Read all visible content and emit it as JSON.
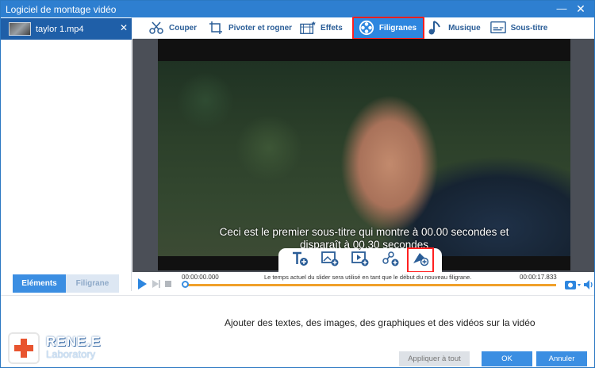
{
  "window": {
    "title": "Logiciel de montage vidéo",
    "minimize_label": "—",
    "close_label": "✕"
  },
  "sidebar": {
    "file_name": "taylor 1.mp4",
    "file_close": "✕"
  },
  "tabs": [
    {
      "label": "Couper",
      "icon": "cut-icon"
    },
    {
      "label": "Pivoter et rogner",
      "icon": "rotate-crop-icon"
    },
    {
      "label": "Effets",
      "icon": "effects-icon"
    },
    {
      "label": "Filigranes",
      "icon": "watermark-reel-icon",
      "active": true
    },
    {
      "label": "Musique",
      "icon": "music-note-icon"
    },
    {
      "label": "Sous-titre",
      "icon": "subtitle-icon"
    }
  ],
  "video": {
    "subtitle_line1": "Ceci est le premier sous-titre qui montre à 00.00 secondes et",
    "subtitle_line2": "disparaît à 00.30 secondes"
  },
  "toolpanel": [
    "add-text-icon",
    "add-image-icon",
    "add-video-icon",
    "add-shape-icon",
    "add-graphic-icon"
  ],
  "bottom_tabs": {
    "elements": "Eléments",
    "watermark": "Filigrane"
  },
  "timeline": {
    "start": "00:00:00.000",
    "end": "00:00:17.833",
    "info": "Le temps actuel du slider sera utilisé en tant que le début du nouveau filigrane."
  },
  "footer": {
    "hint": "Ajouter des textes, des images, des graphiques et des vidéos sur la vidéo",
    "apply_all": "Appliquer à tout",
    "ok": "OK",
    "cancel": "Annuler",
    "logo_line1": "RENE.E",
    "logo_line2": "Laboratory"
  },
  "colors": {
    "accent": "#2d86df",
    "title_bar": "#2e7fd0",
    "highlight": "#ff1f1f",
    "progress": "#f0a02a"
  }
}
